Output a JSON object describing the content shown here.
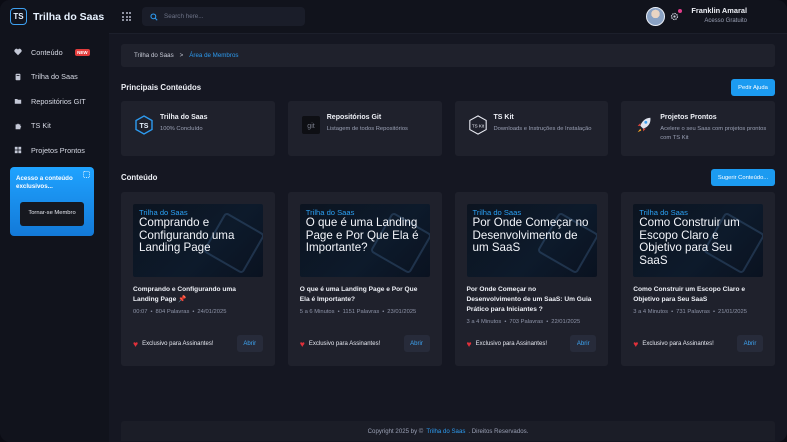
{
  "app": {
    "logo_badge": "TS",
    "logo_text": "Trilha do Saas"
  },
  "sidebar": {
    "items": [
      {
        "label": "Conteúdo",
        "badge": "NEW",
        "icon": "heart-icon"
      },
      {
        "label": "Trilha do Saas",
        "icon": "book-icon"
      },
      {
        "label": "Repositórios GIT",
        "icon": "folder-icon"
      },
      {
        "label": "TS Kit",
        "icon": "puzzle-icon"
      },
      {
        "label": "Projetos Prontos",
        "icon": "grid-icon"
      }
    ],
    "promo": {
      "text": "Acesso a conteúdo exclusivos...",
      "button": "Tornar-se Membro"
    }
  },
  "topbar": {
    "search_placeholder": "Search here...",
    "user_name": "Franklin Amaral",
    "user_role": "Acesso Gratuito"
  },
  "breadcrumb": {
    "root": "Trilha do Saas",
    "separator": ">",
    "current": "Área de Membros"
  },
  "principais": {
    "title": "Principais Conteúdos",
    "help_button": "Pedir Ajuda",
    "cards": [
      {
        "title": "Trilha do Saas",
        "desc": "100% Concluído",
        "icon": "ts-badge-icon"
      },
      {
        "title": "Repositórios Git",
        "desc": "Listagem de todos Repositórios",
        "icon": "git-icon"
      },
      {
        "title": "TS Kit",
        "desc": "Downloads e Instruções de Instalação",
        "icon": "ts-kit-hex-icon"
      },
      {
        "title": "Projetos Prontos",
        "desc": "Acelere o seu Saas com projetos prontos com TS Kit",
        "icon": "rocket-icon"
      }
    ]
  },
  "conteudo": {
    "title": "Conteúdo",
    "suggest_button": "Sugerir Conteúdo...",
    "cards": [
      {
        "thumb_brand": "Trilha do Saas",
        "thumb_title": "Comprando e Configurando uma Landing Page",
        "title": "Comprando e Configurando uma Landing Page 📌",
        "duration": "00:07",
        "words": "804 Palavras",
        "date": "24/01/2025",
        "exclusive": "Exclusivo para Assinantes!",
        "open": "Abrir"
      },
      {
        "thumb_brand": "Trilha do Saas",
        "thumb_title": "O que é uma Landing Page e Por Que Ela é Importante?",
        "title": "O que é uma Landing Page e Por Que Ela é Importante?",
        "duration": "5 a 6 Minutos",
        "words": "1151 Palavras",
        "date": "23/01/2025",
        "exclusive": "Exclusivo para Assinantes!",
        "open": "Abrir"
      },
      {
        "thumb_brand": "Trilha do Saas",
        "thumb_title": "Por Onde Começar no Desenvolvimento de um SaaS",
        "title": "Por Onde Começar no Desenvolvimento de um SaaS: Um Guia Prático para Iniciantes ?",
        "duration": "3 a 4 Minutos",
        "words": "703 Palavras",
        "date": "22/01/2025",
        "exclusive": "Exclusivo para Assinantes!",
        "open": "Abrir"
      },
      {
        "thumb_brand": "Trilha do Saas",
        "thumb_title": "Como Construir um Escopo Claro e Objetivo para Seu SaaS",
        "title": "Como Construir um Escopo Claro e Objetivo para Seu SaaS",
        "duration": "3 a 4 Minutos",
        "words": "731 Palavras",
        "date": "21/01/2025",
        "exclusive": "Exclusivo para Assinantes!",
        "open": "Abrir"
      }
    ]
  },
  "footer": {
    "prefix": "Copyright 2025 by ©",
    "brand": "Trilha do Saas",
    "suffix": ". Direitos Reservados."
  },
  "colors": {
    "accent": "#1c9bf1",
    "background": "#151722",
    "card": "#1f212c",
    "heart": "#e0303a"
  }
}
